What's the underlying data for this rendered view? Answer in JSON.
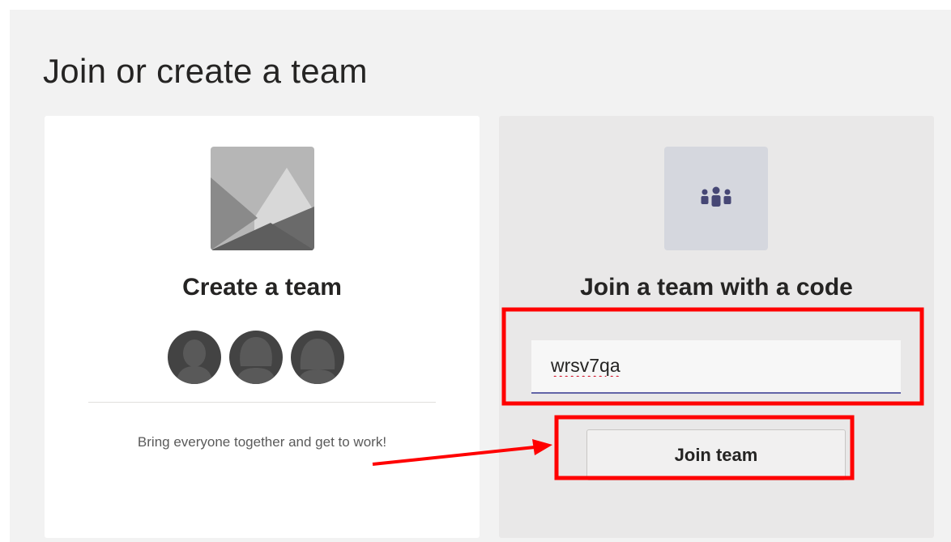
{
  "page": {
    "title": "Join or create a team"
  },
  "create_card": {
    "heading": "Create a team",
    "description": "Bring everyone together and get to work!",
    "image_icon": "landscape-placeholder-icon",
    "avatar_icon": "person-avatar-icon",
    "avatar_count": 3
  },
  "join_card": {
    "heading": "Join a team with a code",
    "icon": "team-people-icon",
    "code_input": {
      "value": "wrsv7qa"
    },
    "join_button_label": "Join team"
  },
  "annotations": {
    "highlight_color": "#ff0000",
    "arrow_icon": "red-arrow-icon"
  },
  "colors": {
    "background": "#f2f2f2",
    "card_active": "#e9e8e8",
    "accent": "#6264a7"
  }
}
